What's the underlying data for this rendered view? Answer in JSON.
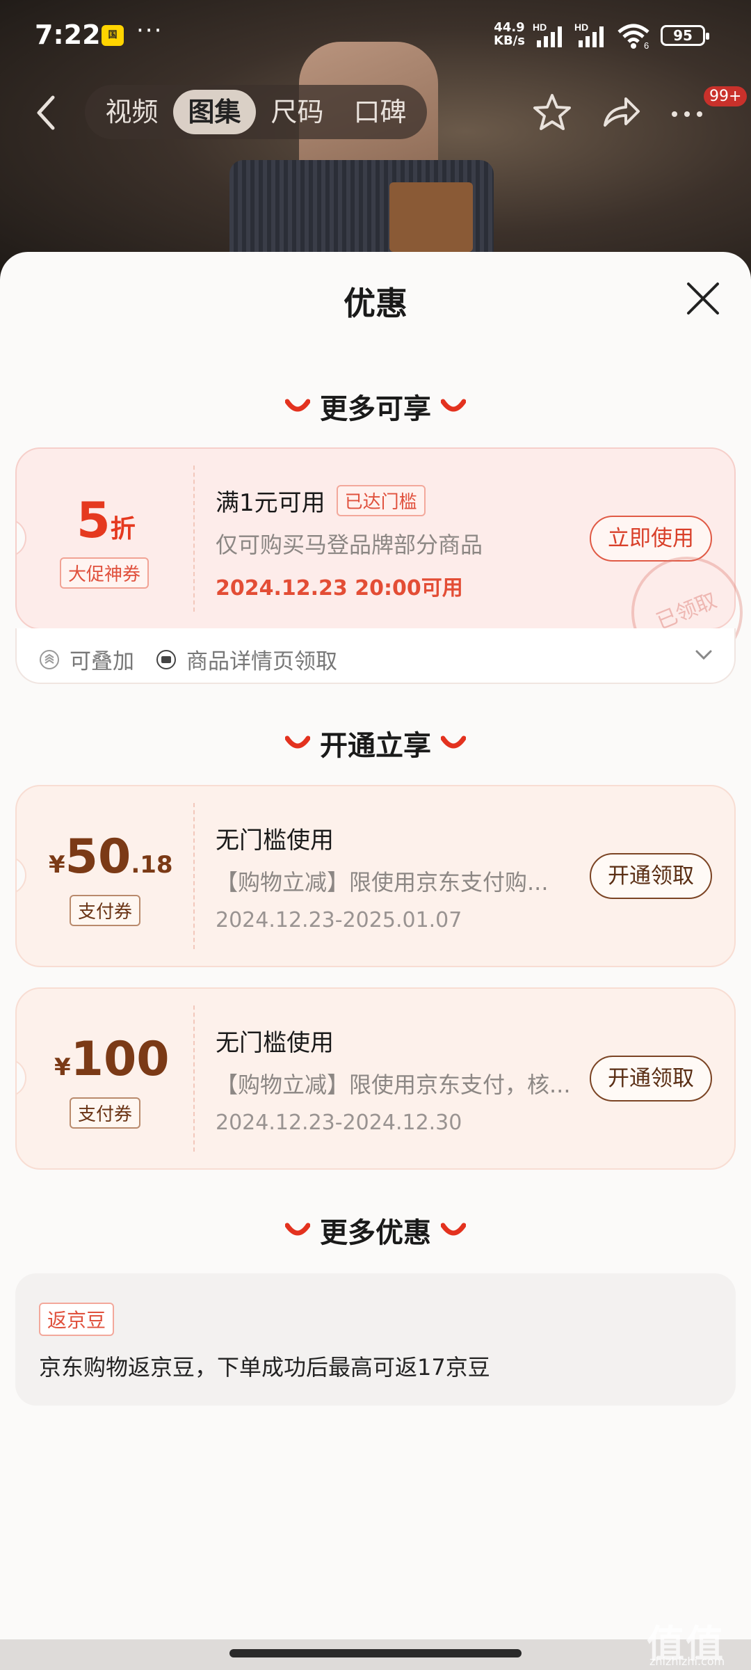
{
  "status_bar": {
    "time": "7:22",
    "app_badge": "国",
    "more": "···",
    "net_speed_value": "44.9",
    "net_speed_unit": "KB/s",
    "hd1": "HD",
    "hd2": "HD",
    "wifi_num": "6",
    "battery": "95"
  },
  "nav": {
    "tabs": [
      {
        "label": "视频",
        "active": false
      },
      {
        "label": "图集",
        "active": true
      },
      {
        "label": "尺码",
        "active": false
      },
      {
        "label": "口碑",
        "active": false
      }
    ],
    "badge": "99+"
  },
  "sheet": {
    "title": "优惠"
  },
  "sections": {
    "more_available": "更多可享",
    "open_now": "开通立享",
    "more_deals": "更多优惠"
  },
  "coupon1": {
    "value": "5",
    "unit": "折",
    "kind": "大促神券",
    "title": "满1元可用",
    "tag": "已达门槛",
    "desc": "仅可购买马登品牌部分商品",
    "date": "2024.12.23 20:00可用",
    "button": "立即使用",
    "stamp": "已领取",
    "foot_stack": "可叠加",
    "foot_source": "商品详情页领取"
  },
  "coupon2": {
    "currency": "¥",
    "value_int": "50",
    "value_dec": ".18",
    "kind": "支付券",
    "title": "无门槛使用",
    "desc": "【购物立减】限使用京东支付购...",
    "date": "2024.12.23-2025.01.07",
    "button": "开通领取"
  },
  "coupon3": {
    "currency": "¥",
    "value_int": "100",
    "kind": "支付券",
    "title": "无门槛使用",
    "desc": "【购物立减】限使用京东支付，核...",
    "date": "2024.12.23-2024.12.30",
    "button": "开通领取"
  },
  "more": {
    "tag": "返京豆",
    "text": "京东购物返京豆，下单成功后最高可返17京豆"
  },
  "watermark": {
    "logo": "值值值",
    "site": "zhizhizhi.com"
  },
  "colors": {
    "accent_red": "#e34d35",
    "brown": "#7b3a16",
    "pink_card": "#fdecea",
    "peach_card": "#fdf1eb"
  }
}
